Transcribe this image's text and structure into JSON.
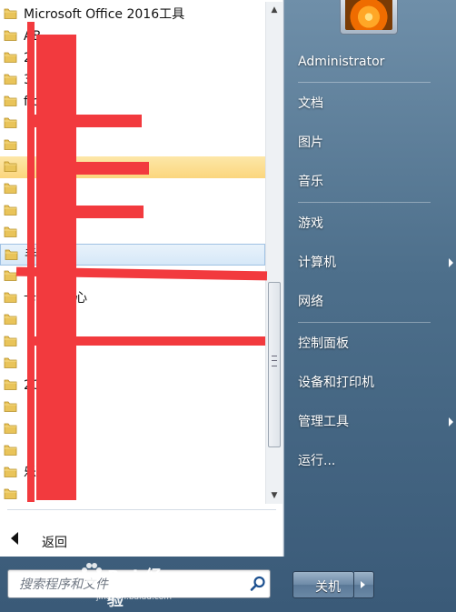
{
  "programs": [
    {
      "label": "Microsoft Office 2016工具",
      "state": "normal"
    },
    {
      "label": "AB",
      "state": "normal"
    },
    {
      "label": "2.7",
      "state": "normal"
    },
    {
      "label": "3.5",
      "state": "normal"
    },
    {
      "label": "fice",
      "state": "normal"
    },
    {
      "label": "",
      "state": "normal"
    },
    {
      "label": "",
      "state": "normal"
    },
    {
      "label": "",
      "state": "highlighted"
    },
    {
      "label": "",
      "state": "normal"
    },
    {
      "label": "",
      "state": "normal"
    },
    {
      "label": "",
      "state": "normal"
    },
    {
      "label": "手",
      "state": "hover"
    },
    {
      "label": "",
      "state": "normal"
    },
    {
      "label": "卡交易中心",
      "state": "normal"
    },
    {
      "label": "",
      "state": "normal"
    },
    {
      "label": "",
      "state": "normal"
    },
    {
      "label": "",
      "state": "normal"
    },
    {
      "label": "2013",
      "state": "normal"
    },
    {
      "label": "",
      "state": "normal"
    },
    {
      "label": "",
      "state": "normal"
    },
    {
      "label": "",
      "state": "normal"
    },
    {
      "label": "乐",
      "state": "normal"
    },
    {
      "label": "",
      "state": "normal"
    }
  ],
  "back": {
    "label": "返回"
  },
  "search": {
    "placeholder": "搜索程序和文件"
  },
  "right_nav": [
    {
      "label": "Administrator",
      "has_arrow": false
    },
    {
      "label": "文档",
      "has_arrow": false
    },
    {
      "label": "图片",
      "has_arrow": false
    },
    {
      "label": "音乐",
      "has_arrow": false
    },
    {
      "label": "游戏",
      "has_arrow": false
    },
    {
      "label": "计算机",
      "has_arrow": true
    },
    {
      "label": "网络",
      "has_arrow": false
    },
    {
      "label": "控制面板",
      "has_arrow": false
    },
    {
      "label": "设备和打印机",
      "has_arrow": false
    },
    {
      "label": "管理工具",
      "has_arrow": true
    },
    {
      "label": "运行...",
      "has_arrow": false
    }
  ],
  "shutdown": {
    "label": "关机"
  },
  "watermark": {
    "text": "Bai 经验",
    "url": "jingyan.baidu.com"
  },
  "colors": {
    "highlight": "#fbd67d",
    "hover": "#d6e8f8",
    "redaction": "#f23a3e",
    "folder": "#e9c45a"
  },
  "icons": {
    "program_item": "folder-icon",
    "search": "search-icon",
    "back": "back-arrow-icon",
    "submenu": "chevron-right-icon"
  }
}
